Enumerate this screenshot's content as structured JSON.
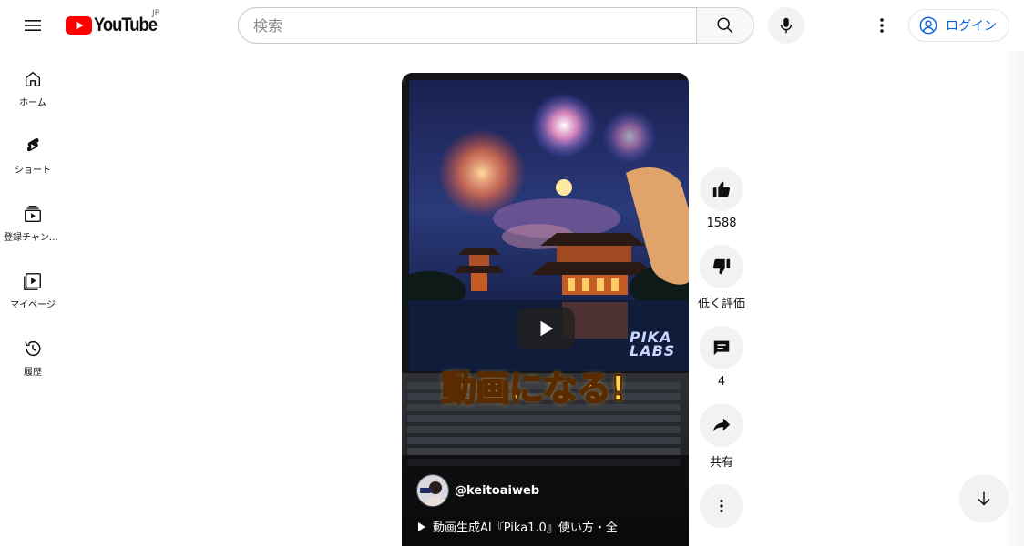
{
  "header": {
    "logo_text": "YouTube",
    "country_code": "JP",
    "search_placeholder": "検索",
    "login_label": "ログイン"
  },
  "sidebar": {
    "items": [
      {
        "label": "ホーム",
        "icon": "home-icon"
      },
      {
        "label": "ショート",
        "icon": "shorts-icon"
      },
      {
        "label": "登録チャンネル",
        "icon": "subscriptions-icon"
      },
      {
        "label": "マイページ",
        "icon": "library-icon"
      },
      {
        "label": "履歴",
        "icon": "history-icon"
      }
    ]
  },
  "video": {
    "overlay_caption": "動画になる!",
    "watermark": "PIKA LABS",
    "channel_handle": "@keitoaiweb",
    "title": "動画生成AI『Pika1.0』使い方・全"
  },
  "actions": {
    "like_count": "1588",
    "dislike_label": "低く評価",
    "comment_count": "4",
    "share_label": "共有"
  },
  "colors": {
    "brand_red": "#ff0000",
    "link_blue": "#065fd4",
    "button_bg": "#f2f2f2"
  }
}
